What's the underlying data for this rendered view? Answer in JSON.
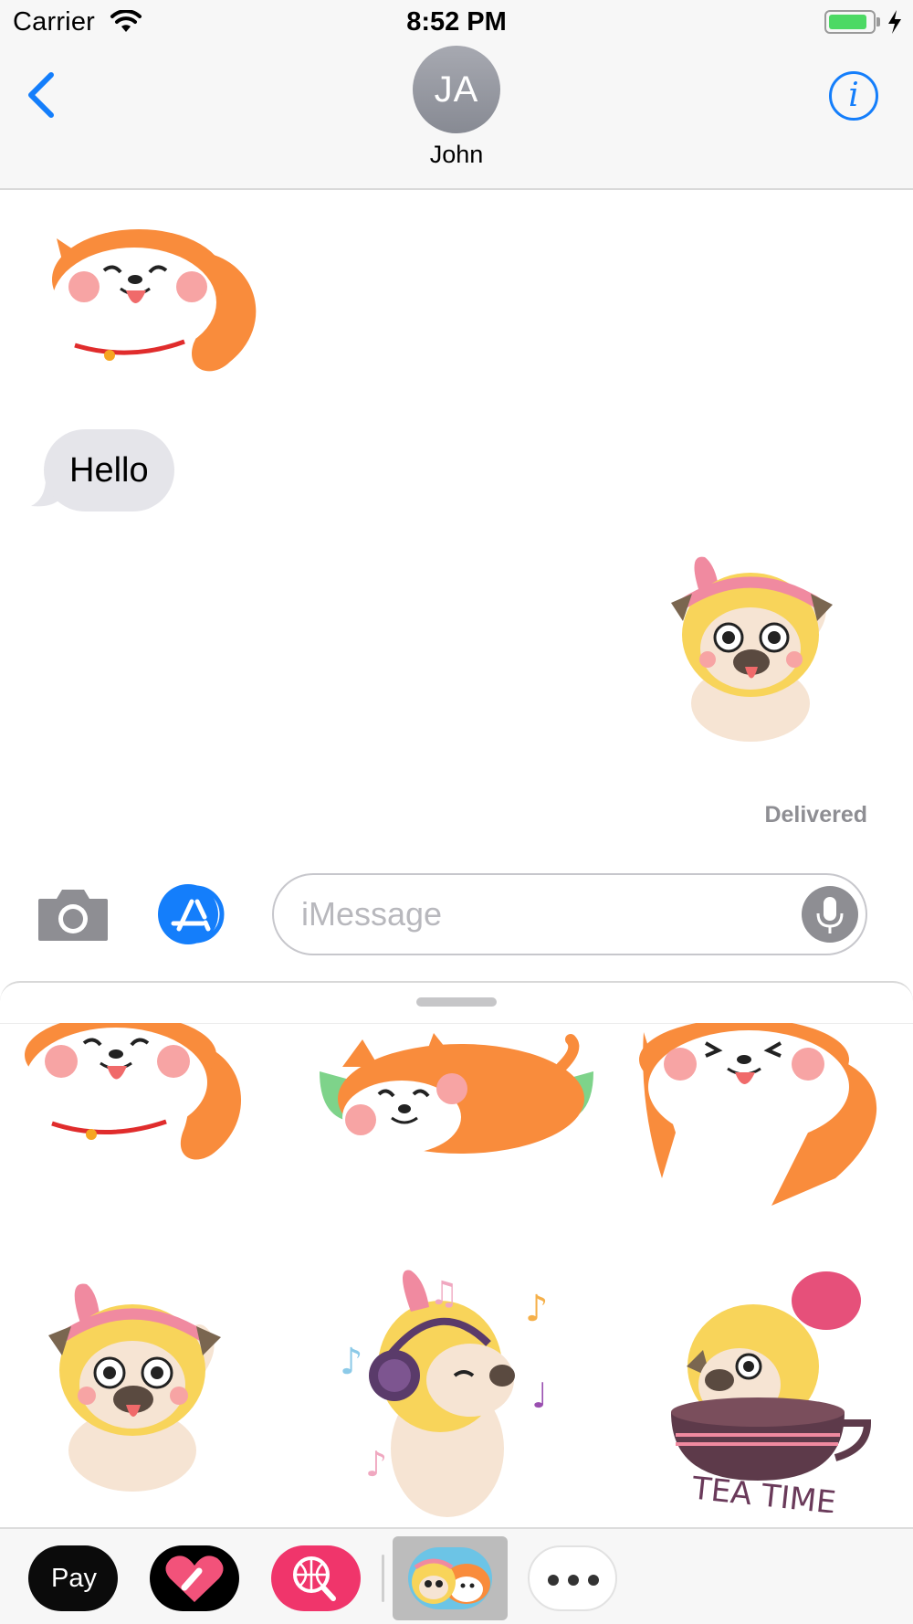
{
  "status_bar": {
    "carrier": "Carrier",
    "time": "8:52 PM",
    "battery_level": 0.9
  },
  "nav": {
    "contact_initials": "JA",
    "contact_name": "John"
  },
  "conversation": {
    "received_sticker": "shiba-dog-sticker",
    "received_message": "Hello",
    "sent_sticker": "pug-girl-waving-sticker",
    "status": "Delivered"
  },
  "input": {
    "placeholder": "iMessage",
    "value": ""
  },
  "drawer": {
    "stickers": [
      {
        "name": "shiba-happy-sticker"
      },
      {
        "name": "shiba-flying-sticker"
      },
      {
        "name": "shiba-jumping-sticker"
      },
      {
        "name": "pug-girl-waving-sticker"
      },
      {
        "name": "pug-girl-music-sticker"
      },
      {
        "name": "pug-tea-time-sticker",
        "caption": "TEA TIME"
      }
    ]
  },
  "app_strip": {
    "apple_pay_label": "Pay",
    "apps": [
      "apple-pay",
      "digital-touch",
      "image-search",
      "pug-shiba-stickers",
      "more"
    ]
  },
  "colors": {
    "accent": "#147efb",
    "bubble_gray": "#e5e5ea",
    "shiba_orange": "#f98c3c",
    "pug_hair": "#f8d45a",
    "headband_pink": "#f08aa0"
  }
}
